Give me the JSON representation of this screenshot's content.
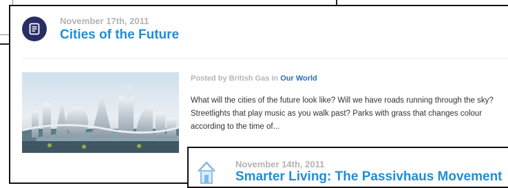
{
  "post": {
    "icon": "document-icon",
    "date": "November 17th, 2011",
    "title": "Cities of the Future",
    "meta_prefix": "Posted by British Gas in",
    "category": "Our World",
    "excerpt": "What will the cities of the future look like? Will we have roads running through the sky? Streetlights that play music as you walk past? Parks with grass that changes colour according to the time of...",
    "accent_color": "#1f8ed6",
    "icon_bg_color": "#2a2d63"
  },
  "next_post": {
    "icon": "house-icon",
    "date": "November 14th, 2011",
    "title": "Smarter Living: The Passivhaus Movement"
  }
}
